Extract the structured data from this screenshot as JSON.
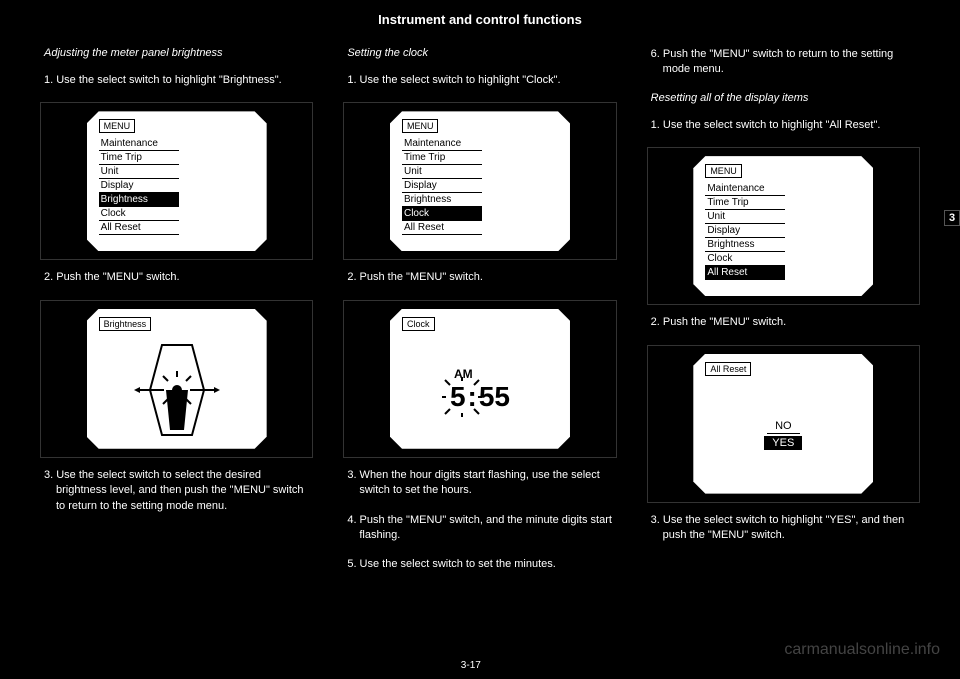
{
  "book_title": "",
  "header": "Instrument and control functions",
  "page_tab": "3",
  "page_num": "3-17",
  "watermark": "carmanualsonline.info",
  "col1": {
    "section_label1": "Adjusting the meter panel brightness",
    "step1": "1. Use the select switch to highlight \"Brightness\".",
    "panel1_label": "MENU",
    "menu1": [
      {
        "label": "Maintenance",
        "selected": false
      },
      {
        "label": "Time Trip",
        "selected": false
      },
      {
        "label": "Unit",
        "selected": false
      },
      {
        "label": "Display",
        "selected": false
      },
      {
        "label": "Brightness",
        "selected": true
      },
      {
        "label": "Clock",
        "selected": false
      },
      {
        "label": "All Reset",
        "selected": false
      }
    ],
    "step2": "2. Push the \"MENU\" switch.",
    "panel2_label": "Brightness",
    "step3": "3. Use the select switch to select the desired brightness level, and then push the \"MENU\" switch to return to the setting mode menu."
  },
  "col2": {
    "section_label1": "Setting the clock",
    "step1": "1. Use the select switch to highlight \"Clock\".",
    "panel1_label": "MENU",
    "menu1": [
      {
        "label": "Maintenance",
        "selected": false
      },
      {
        "label": "Time Trip",
        "selected": false
      },
      {
        "label": "Unit",
        "selected": false
      },
      {
        "label": "Display",
        "selected": false
      },
      {
        "label": "Brightness",
        "selected": false
      },
      {
        "label": "Clock",
        "selected": true
      },
      {
        "label": "All Reset",
        "selected": false
      }
    ],
    "step2": "2. Push the \"MENU\" switch.",
    "panel2_label": "Clock",
    "clock_ampm": "AM",
    "clock_hour": "5",
    "clock_sep": ":",
    "clock_min": "55",
    "step3": "3. When the hour digits start flashing, use the select switch to set the hours.",
    "step4": "4. Push the \"MENU\" switch, and the minute digits start flashing.",
    "step5": "5. Use the select switch to set the minutes."
  },
  "col3": {
    "step1": "6. Push the \"MENU\" switch to return to the setting mode menu.",
    "section_label1": "Resetting all of the display items",
    "step2": "1. Use the select switch to highlight \"All Reset\".",
    "panel1_label": "MENU",
    "menu1": [
      {
        "label": "Maintenance",
        "selected": false
      },
      {
        "label": "Time Trip",
        "selected": false
      },
      {
        "label": "Unit",
        "selected": false
      },
      {
        "label": "Display",
        "selected": false
      },
      {
        "label": "Brightness",
        "selected": false
      },
      {
        "label": "Clock",
        "selected": false
      },
      {
        "label": "All Reset",
        "selected": true
      }
    ],
    "step3": "2. Push the \"MENU\" switch.",
    "panel2_label": "All Reset",
    "allreset_no": "NO",
    "allreset_yes": "YES",
    "step4": "3. Use the select switch to highlight \"YES\", and then push the \"MENU\" switch."
  }
}
